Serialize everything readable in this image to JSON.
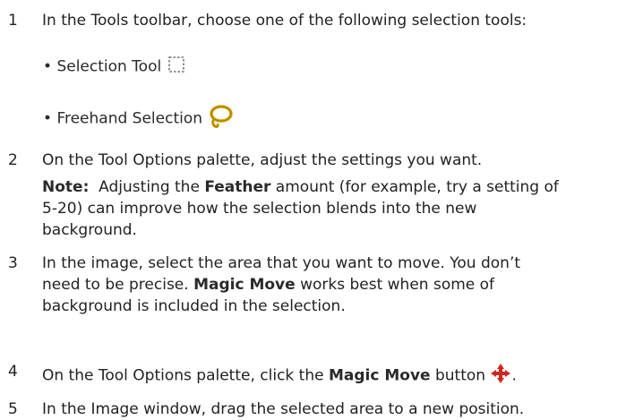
{
  "steps": [
    {
      "num": "1",
      "text": "In the Tools toolbar, choose one of the following selection tools:"
    },
    {
      "num": "2",
      "text": "On the Tool Options palette, adjust the settings you want."
    },
    {
      "num": "3",
      "line1": "In the image, select the area that you want to move. You don’t",
      "line2_pre": "need to be precise. ",
      "line2_bold": "Magic Move",
      "line2_post": " works best when some of",
      "line3": "background is included in the selection."
    },
    {
      "num": "4",
      "pre": "On the Tool Options palette, click the ",
      "bold": "Magic Move",
      "post": " button",
      "end": "."
    },
    {
      "num": "5",
      "text": "In the Image window, drag the selected area to a new position."
    }
  ],
  "bullets": [
    {
      "text": "Selection Tool",
      "icon": "selection-tool-icon"
    },
    {
      "text": "Freehand Selection",
      "icon": "freehand-selection-icon"
    }
  ],
  "note": {
    "label": "Note:",
    "pre": "  Adjusting the ",
    "bold": "Feather",
    "post": " amount (for example, try a setting of",
    "line2": "5-20) can improve how the selection blends into the new",
    "line3": "background."
  },
  "icons": {
    "lasso_color": "#d8a400",
    "magic_move_color": "#d2261e"
  }
}
